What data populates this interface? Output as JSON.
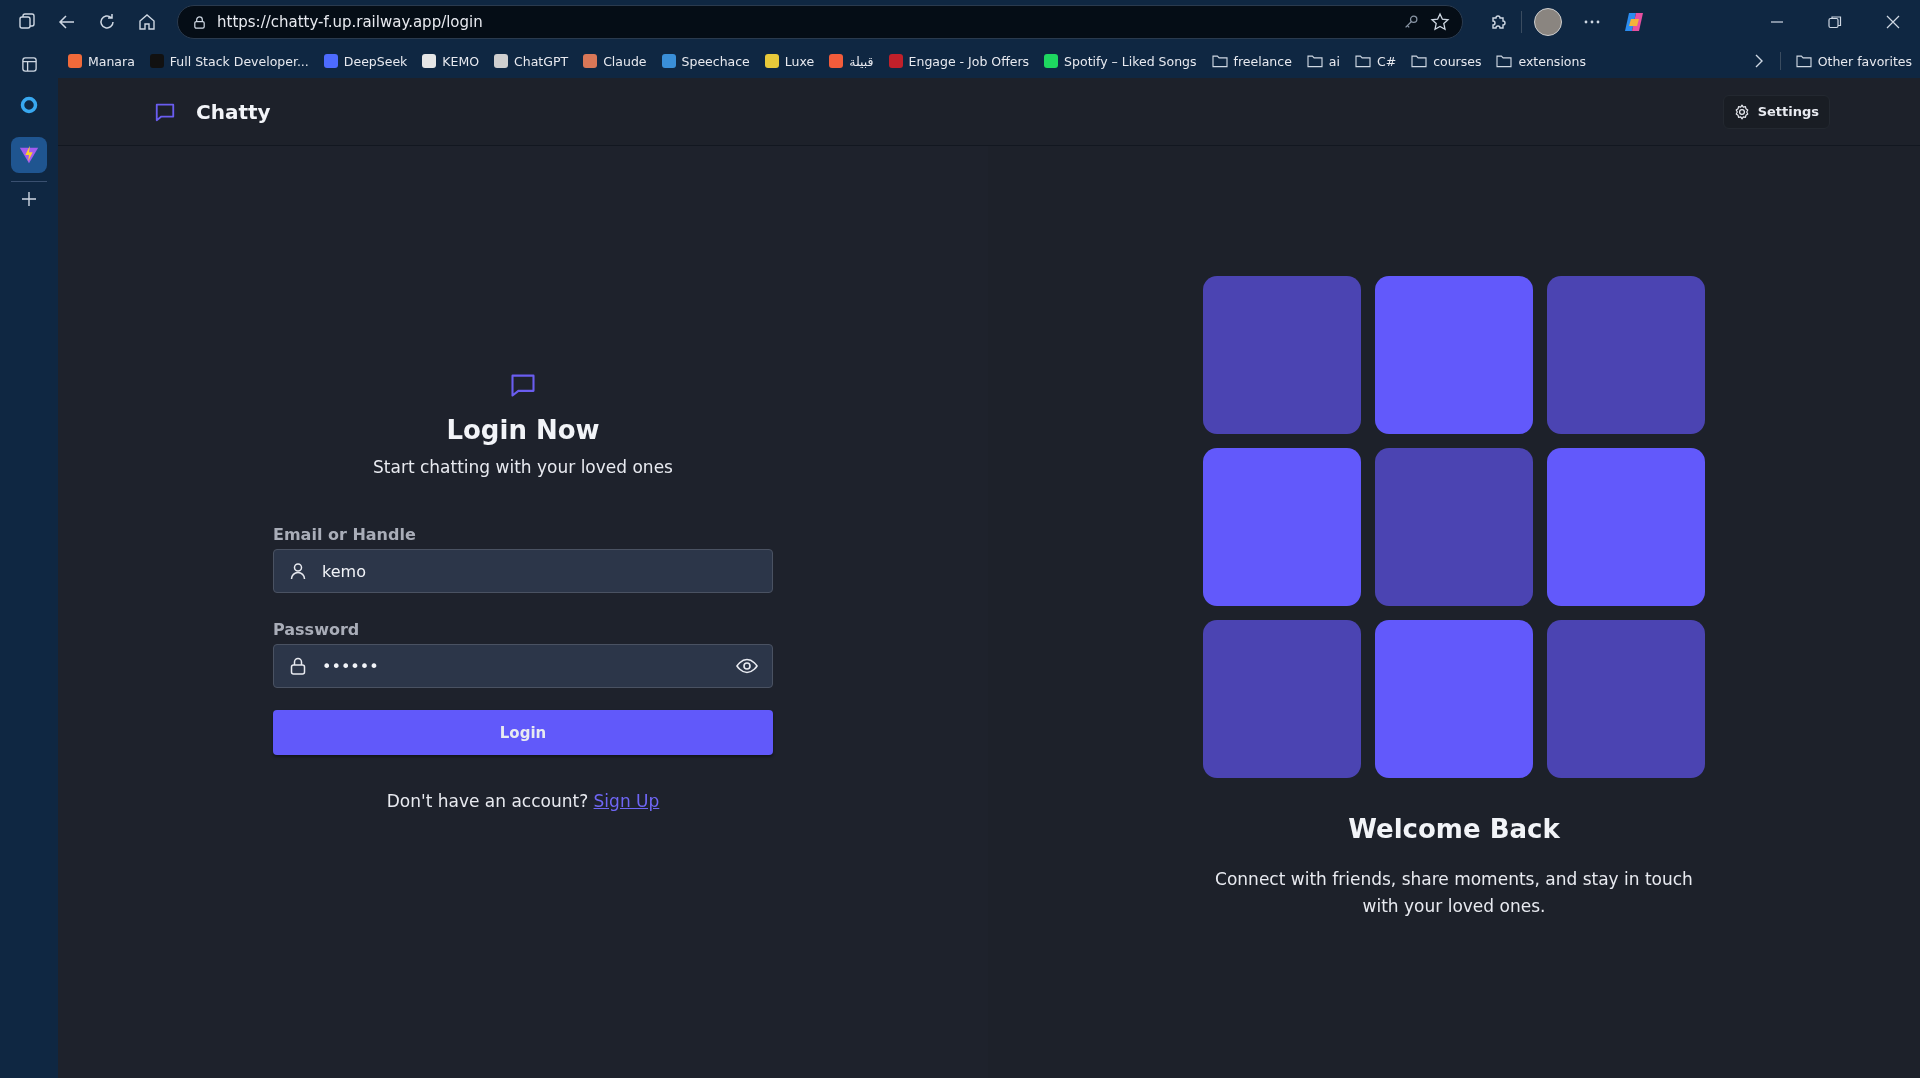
{
  "browser": {
    "url": "https://chatty-f.up.railway.app/login",
    "bookmarks": [
      {
        "kind": "site",
        "label": "Manara",
        "color": "#f06a3a"
      },
      {
        "kind": "site",
        "label": "Full Stack Developer...",
        "color": "#111111"
      },
      {
        "kind": "site",
        "label": "DeepSeek",
        "color": "#4d6bfe"
      },
      {
        "kind": "site",
        "label": "KEMO",
        "color": "#e6e6e6"
      },
      {
        "kind": "site",
        "label": "ChatGPT",
        "color": "#cfcfcf"
      },
      {
        "kind": "site",
        "label": "Claude",
        "color": "#d97757"
      },
      {
        "kind": "site",
        "label": "Speechace",
        "color": "#3a8fd8"
      },
      {
        "kind": "site",
        "label": "Luxe",
        "color": "#e8c93a"
      },
      {
        "kind": "site",
        "label": "قبيلة",
        "color": "#f25c3b"
      },
      {
        "kind": "site",
        "label": "Engage - Job Offers",
        "color": "#c0202a"
      },
      {
        "kind": "site",
        "label": "Spotify – Liked Songs",
        "color": "#1ed760"
      },
      {
        "kind": "folder",
        "label": "freelance"
      },
      {
        "kind": "folder",
        "label": "ai"
      },
      {
        "kind": "folder",
        "label": "C#"
      },
      {
        "kind": "folder",
        "label": "courses"
      },
      {
        "kind": "folder",
        "label": "extensions"
      }
    ],
    "other_favorites": "Other favorites",
    "side_apps": [
      {
        "kind": "circle",
        "selected": false
      },
      {
        "kind": "bolt",
        "selected": true
      }
    ]
  },
  "header": {
    "brand": "Chatty",
    "settings": "Settings"
  },
  "login": {
    "title": "Login Now",
    "subtitle": "Start chatting with your loved ones",
    "fields": [
      {
        "kind": "user",
        "label": "Email or Handle",
        "value": "kemo"
      },
      {
        "kind": "password",
        "label": "Password",
        "value": "••••••"
      }
    ],
    "button": "Login",
    "prompt": "Don't have an account?",
    "link": "Sign Up"
  },
  "welcome": {
    "tiles": [
      {
        "highlighted": false
      },
      {
        "highlighted": true
      },
      {
        "highlighted": false
      },
      {
        "highlighted": true
      },
      {
        "highlighted": false
      },
      {
        "highlighted": true
      },
      {
        "highlighted": false
      },
      {
        "highlighted": true
      },
      {
        "highlighted": false
      }
    ],
    "title": "Welcome Back",
    "text": "Connect with friends, share moments, and stay in touch with your loved ones."
  }
}
